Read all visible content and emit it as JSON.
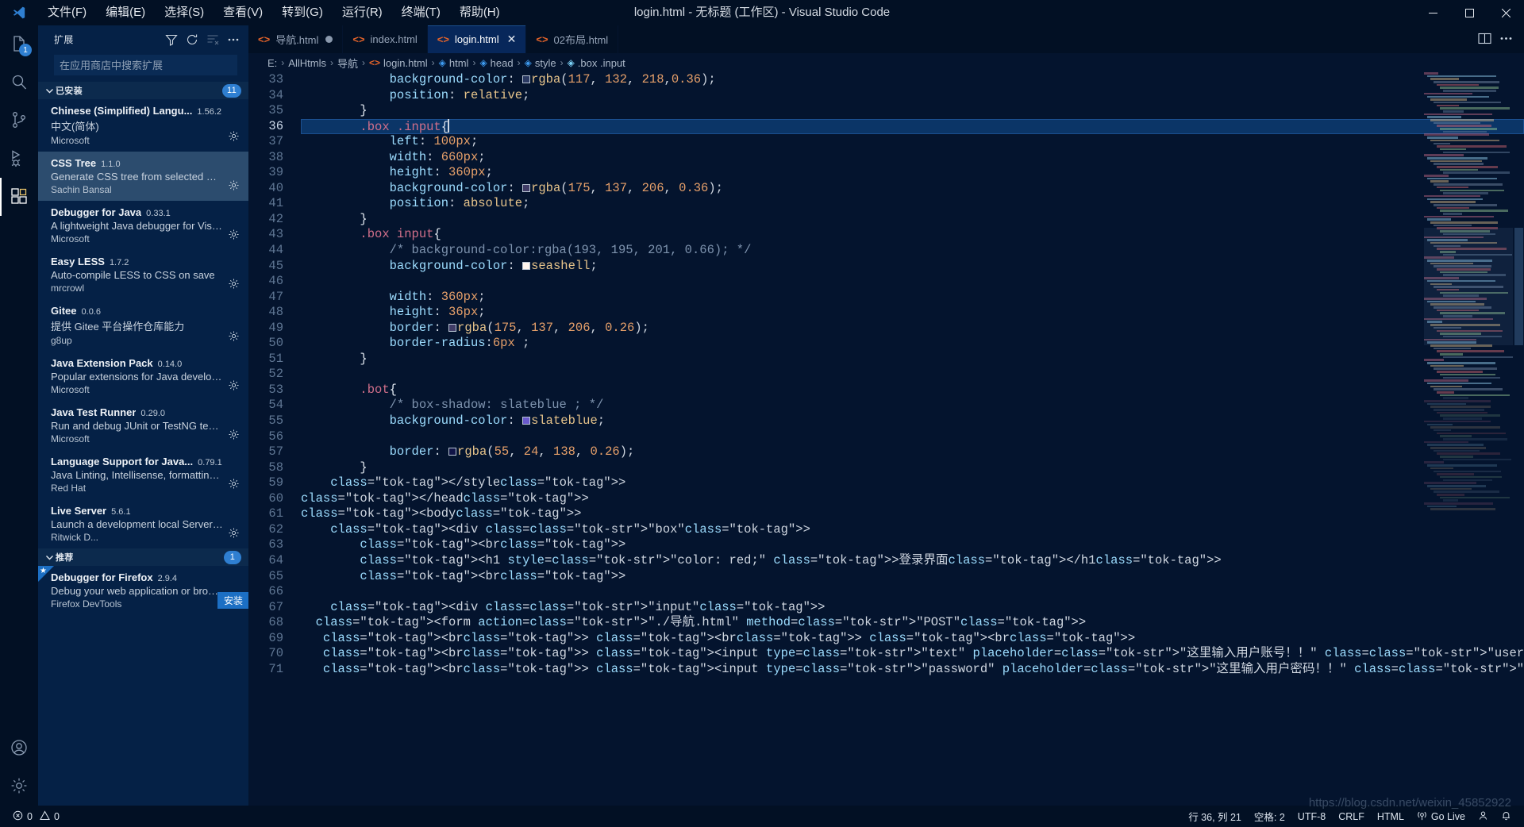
{
  "window": {
    "title": "login.html - 无标题 (工作区) - Visual Studio Code",
    "minimize": "—",
    "maximize": "▢",
    "close": "✕"
  },
  "menu": [
    {
      "label": "文件(F)",
      "name": "menu-file"
    },
    {
      "label": "编辑(E)",
      "name": "menu-edit"
    },
    {
      "label": "选择(S)",
      "name": "menu-selection"
    },
    {
      "label": "查看(V)",
      "name": "menu-view"
    },
    {
      "label": "转到(G)",
      "name": "menu-go"
    },
    {
      "label": "运行(R)",
      "name": "menu-run"
    },
    {
      "label": "终端(T)",
      "name": "menu-terminal"
    },
    {
      "label": "帮助(H)",
      "name": "menu-help"
    }
  ],
  "activitybar": {
    "explorer_badge": "1",
    "items": [
      "explorer",
      "search",
      "source-control",
      "run-and-debug",
      "extensions",
      "accounts",
      "settings"
    ]
  },
  "sidebar": {
    "title": "扩展",
    "search": {
      "placeholder": "在应用商店中搜索扩展",
      "value": ""
    },
    "actions": [
      "filter-icon",
      "refresh-icon",
      "clear-search-icon",
      "more-actions-icon"
    ],
    "sections": [
      {
        "title": "已安装",
        "count": "11",
        "items": [
          {
            "name": "Chinese (Simplified) Langu...",
            "version": "1.56.2",
            "description": "中文(简体)",
            "publisher": "Microsoft",
            "selected": false,
            "gear": true
          },
          {
            "name": "CSS Tree",
            "version": "1.1.0",
            "description": "Generate CSS tree from selected HTM...",
            "publisher": "Sachin Bansal",
            "selected": true,
            "gear": true
          },
          {
            "name": "Debugger for Java",
            "version": "0.33.1",
            "description": "A lightweight Java debugger for Visua...",
            "publisher": "Microsoft",
            "selected": false,
            "gear": true
          },
          {
            "name": "Easy LESS",
            "version": "1.7.2",
            "description": "Auto-compile LESS to CSS on save",
            "publisher": "mrcrowl",
            "selected": false,
            "gear": true
          },
          {
            "name": "Gitee",
            "version": "0.0.6",
            "description": "提供 Gitee 平台操作仓库能力",
            "publisher": "g8up",
            "selected": false,
            "gear": true
          },
          {
            "name": "Java Extension Pack",
            "version": "0.14.0",
            "description": "Popular extensions for Java developm...",
            "publisher": "Microsoft",
            "selected": false,
            "gear": true
          },
          {
            "name": "Java Test Runner",
            "version": "0.29.0",
            "description": "Run and debug JUnit or TestNG test c...",
            "publisher": "Microsoft",
            "selected": false,
            "gear": true
          },
          {
            "name": "Language Support for Java...",
            "version": "0.79.1",
            "description": "Java Linting, Intellisense, formatting, r...",
            "publisher": "Red Hat",
            "selected": false,
            "gear": true
          },
          {
            "name": "Live Server",
            "version": "5.6.1",
            "description": "Launch a development local Server wi...",
            "publisher": "Ritwick D...",
            "selected": false,
            "gear": true
          }
        ]
      },
      {
        "title": "推荐",
        "count": "1",
        "items": [
          {
            "name": "Debugger for Firefox",
            "version": "2.9.4",
            "description": "Debug your web application or brows...",
            "publisher": "Firefox DevTools",
            "selected": false,
            "install_label": "安装",
            "starred": true
          }
        ]
      }
    ]
  },
  "tabs": [
    {
      "label": "导航.html",
      "modified": true,
      "active": false,
      "closable": false
    },
    {
      "label": "index.html",
      "modified": false,
      "active": false,
      "closable": false
    },
    {
      "label": "login.html",
      "modified": false,
      "active": true,
      "closable": true
    },
    {
      "label": "02布局.html",
      "modified": false,
      "active": false,
      "closable": false
    }
  ],
  "editor_actions": [
    "split-editor-icon",
    "more-actions-icon"
  ],
  "breadcrumb": [
    {
      "label": "E:",
      "icon": "none"
    },
    {
      "label": "AllHtmls",
      "icon": "none"
    },
    {
      "label": "导航",
      "icon": "none"
    },
    {
      "label": "login.html",
      "icon": "html"
    },
    {
      "label": "html",
      "icon": "cube"
    },
    {
      "label": "head",
      "icon": "cube"
    },
    {
      "label": "style",
      "icon": "cube"
    },
    {
      "label": ".box .input",
      "icon": "tag"
    }
  ],
  "code": {
    "first_line": 33,
    "cursor_line": 36,
    "lines": [
      {
        "n": 33,
        "text": "            background-color: rgba(117, 132, 218,0.36);",
        "clipped": true
      },
      {
        "n": 34,
        "text": "            position: relative;"
      },
      {
        "n": 35,
        "text": "        }"
      },
      {
        "n": 36,
        "text": "        .box .input{",
        "highlight": true
      },
      {
        "n": 37,
        "text": "            left: 100px;"
      },
      {
        "n": 38,
        "text": "            width: 660px;"
      },
      {
        "n": 39,
        "text": "            height: 360px;"
      },
      {
        "n": 40,
        "text": "            background-color: rgba(175, 137, 206, 0.36);"
      },
      {
        "n": 41,
        "text": "            position: absolute;"
      },
      {
        "n": 42,
        "text": "        }"
      },
      {
        "n": 43,
        "text": "        .box input{"
      },
      {
        "n": 44,
        "text": "            /* background-color:rgba(193, 195, 201, 0.66); */"
      },
      {
        "n": 45,
        "text": "            background-color: seashell;"
      },
      {
        "n": 46,
        "text": ""
      },
      {
        "n": 47,
        "text": "            width: 360px;"
      },
      {
        "n": 48,
        "text": "            height: 36px;"
      },
      {
        "n": 49,
        "text": "            border: rgba(175, 137, 206, 0.26);"
      },
      {
        "n": 50,
        "text": "            border-radius:6px ;"
      },
      {
        "n": 51,
        "text": "        }"
      },
      {
        "n": 52,
        "text": ""
      },
      {
        "n": 53,
        "text": "        .bot{"
      },
      {
        "n": 54,
        "text": "            /* box-shadow: slateblue ; */"
      },
      {
        "n": 55,
        "text": "            background-color: slateblue;"
      },
      {
        "n": 56,
        "text": ""
      },
      {
        "n": 57,
        "text": "            border: rgba(55, 24, 138, 0.26);"
      },
      {
        "n": 58,
        "text": "        }"
      },
      {
        "n": 59,
        "text": "    </style>"
      },
      {
        "n": 60,
        "text": "</head>"
      },
      {
        "n": 61,
        "text": "<body>"
      },
      {
        "n": 62,
        "text": "    <div class=\"box\">"
      },
      {
        "n": 63,
        "text": "        <br>"
      },
      {
        "n": 64,
        "text": "        <h1 style=\"color: red;\" >登录界面</h1>"
      },
      {
        "n": 65,
        "text": "        <br>"
      },
      {
        "n": 66,
        "text": ""
      },
      {
        "n": 67,
        "text": "    <div class=\"input\">"
      },
      {
        "n": 68,
        "text": "  <form action=\"./导航.html\" method=\"POST\">"
      },
      {
        "n": 69,
        "text": "   <br> <br> <br>"
      },
      {
        "n": 70,
        "text": "   <br> <input type=\"text\" placeholder=\"这里输入用户账号！！\" class=\"user\"><br><br>"
      },
      {
        "n": 71,
        "text": "   <br> <input type=\"password\" placeholder=\"这里输入用户密码！！\" class=\"password\"><br><br>"
      }
    ]
  },
  "statusbar": {
    "errors": "0",
    "warnings": "0",
    "position": "行 36, 列 21",
    "spaces": "空格: 2",
    "encoding": "UTF-8",
    "eol": "CRLF",
    "language": "HTML",
    "golive": "Go Live",
    "account_icon": "account-icon",
    "bell_icon": "bell-icon"
  },
  "watermark": "https://blog.csdn.net/weixin_45852922",
  "colors": {
    "accent": "#1c6fc4",
    "bg": "#04142e",
    "sidebar_bg": "#052146",
    "titlebar_bg": "#021024",
    "selected_row": "#2c4c6e",
    "current_line": "#0b3567",
    "html_icon": "#e3632a"
  }
}
